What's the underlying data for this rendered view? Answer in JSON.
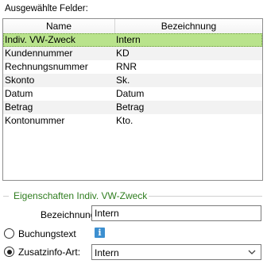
{
  "selected_fields_label": "Ausgewählte Felder:",
  "table": {
    "headers": [
      "Name",
      "Bezeichnung"
    ],
    "rows": [
      {
        "name": "Indiv. VW-Zweck",
        "bezeichnung": "Intern",
        "selected": true
      },
      {
        "name": "Kundennummer",
        "bezeichnung": "KD"
      },
      {
        "name": "Rechnungsnummer",
        "bezeichnung": "RNR"
      },
      {
        "name": "Skonto",
        "bezeichnung": "Sk."
      },
      {
        "name": "Datum",
        "bezeichnung": "Datum"
      },
      {
        "name": "Betrag",
        "bezeichnung": "Betrag"
      },
      {
        "name": "Kontonummer",
        "bezeichnung": "Kto."
      }
    ]
  },
  "properties": {
    "group_title": "Eigenschaften Indiv. VW-Zweck",
    "bezeichnung_label": "Bezeichnung:",
    "bezeichnung_value": "Intern",
    "option_buchungstext": "Buchungstext",
    "option_zusatzinfo": "Zusatzinfo-Art:",
    "zusatzinfo_value": "Intern",
    "info_icon": "info-icon",
    "selected_option": "zusatzinfo"
  },
  "colors": {
    "selection": "#b9e38c",
    "group_title": "#2f7d1f",
    "info": "#3c8fd0"
  }
}
